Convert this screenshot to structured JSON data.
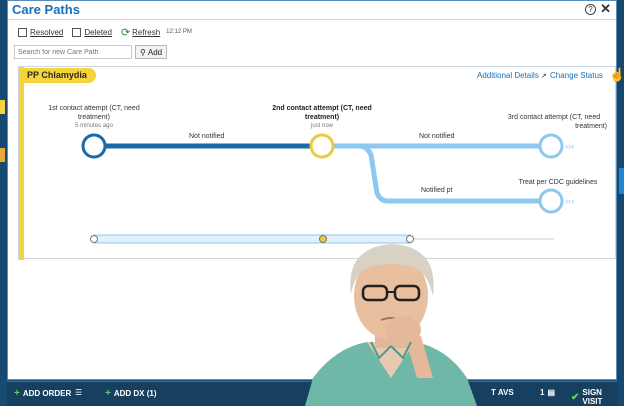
{
  "window": {
    "title": "Care Paths"
  },
  "toolbar": {
    "resolved_label": "Resolved",
    "deleted_label": "Deleted",
    "refresh_label": "Refresh",
    "time": "12:12 PM"
  },
  "search": {
    "placeholder": "Search for new Care Path",
    "add_label": "Add"
  },
  "care_path": {
    "name": "PP Chlamydia",
    "additional_details": "Additional Details",
    "change_status": "Change Status",
    "nodes": [
      {
        "line1": "1st contact attempt (CT, need",
        "line2": "treatment)",
        "sub": "5 minutes ago",
        "color": "#1a6aab"
      },
      {
        "line1": "2nd contact attempt (CT, need",
        "line2": "treatment)",
        "sub": "just now",
        "color": "#f0c93a"
      },
      {
        "line1": "3rd contact attempt (CT, need",
        "line2": "treatment)",
        "sub": "",
        "color": "#8cc8ef"
      },
      {
        "line1": "Treat per CDC guidelines",
        "line2": "",
        "sub": "",
        "color": "#8cc8ef"
      }
    ],
    "edges": [
      {
        "label": "Not notified"
      },
      {
        "label": "Not notified"
      },
      {
        "label": "Notified pt"
      }
    ]
  },
  "bottom": {
    "add_order": "ADD ORDER",
    "add_dx": "ADD DX (1)",
    "avs": "T AVS",
    "count": "1",
    "sign_visit": "SIGN VISIT"
  },
  "colors": {
    "accent": "#f5d33a",
    "brand": "#1a6fb8",
    "path_done": "#1a6aab",
    "path_future": "#8cc8ef"
  }
}
